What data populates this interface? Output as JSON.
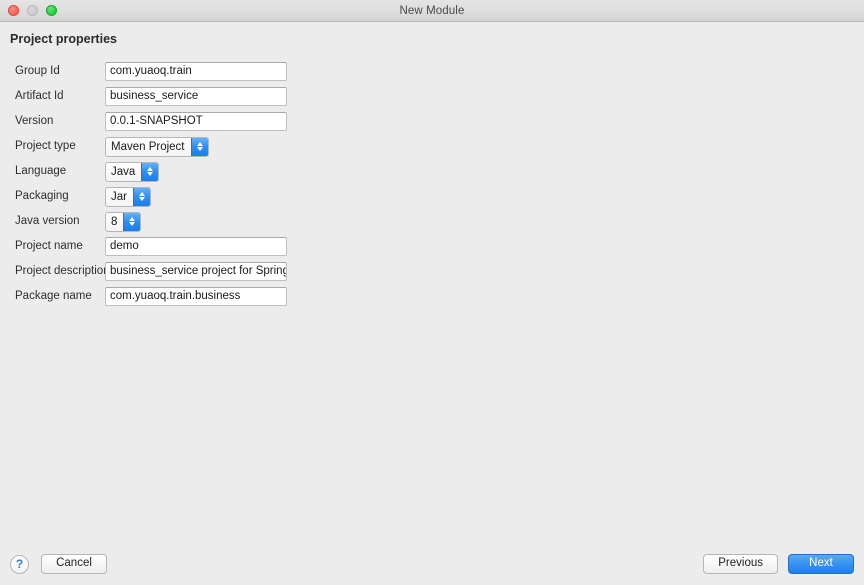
{
  "window": {
    "title": "New Module",
    "traffic_lights": [
      {
        "name": "close",
        "color": "#fb5f57"
      },
      {
        "name": "minimize",
        "color": "#cbcbcb"
      },
      {
        "name": "maximize",
        "color": "#28c840"
      }
    ]
  },
  "main": {
    "section_title": "Project properties",
    "fields": [
      {
        "label": "Group Id",
        "type": "text",
        "value": "com.yuaoq.train"
      },
      {
        "label": "Artifact Id",
        "type": "text",
        "value": "business_service"
      },
      {
        "label": "Version",
        "type": "text",
        "value": "0.0.1-SNAPSHOT"
      },
      {
        "label": "Project type",
        "type": "stepper",
        "value": "Maven Project"
      },
      {
        "label": "Language",
        "type": "stepper",
        "value": "Java"
      },
      {
        "label": "Packaging",
        "type": "stepper",
        "value": "Jar"
      },
      {
        "label": "Java version",
        "type": "stepper",
        "value": "8"
      },
      {
        "label": "Project name",
        "type": "text",
        "value": "demo"
      },
      {
        "label": "Project description",
        "type": "text",
        "value": "business_service project for Spring Boot"
      },
      {
        "label": "Package name",
        "type": "text",
        "value": "com.yuaoq.train.business"
      }
    ]
  },
  "footer": {
    "help_label": "?",
    "cancel_label": "Cancel",
    "previous_label": "Previous",
    "next_label": "Next"
  },
  "colors": {
    "accent": "#1f7fe8",
    "window_background": "#ececec",
    "field_background": "#ffffff"
  }
}
